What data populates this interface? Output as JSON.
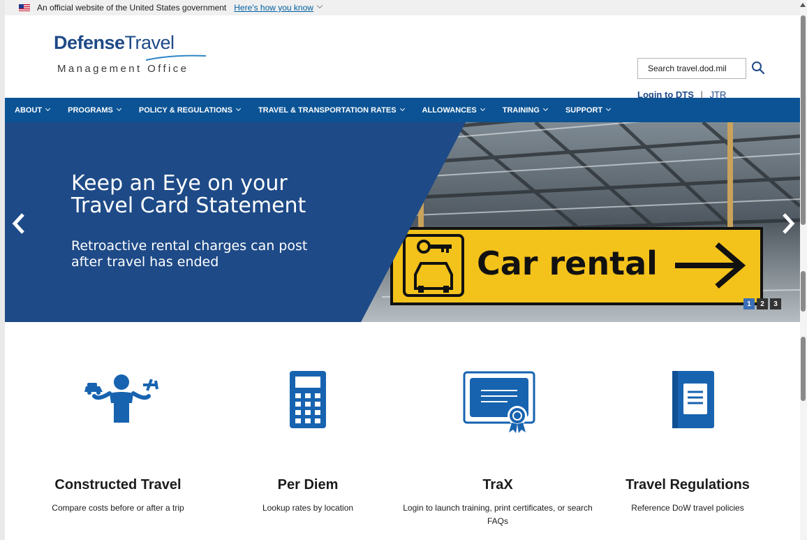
{
  "gov_banner": {
    "text": "An official website of the United States government",
    "link": "Here's how you know"
  },
  "logo": {
    "name_bold": "Defense",
    "name_light": "Travel",
    "subtitle": "Management Office"
  },
  "header": {
    "search_placeholder": "Search travel.dod.mil",
    "login_label": "Login to DTS",
    "separator": "|",
    "jtr_label": "JTR"
  },
  "nav": {
    "items": [
      {
        "label": "ABOUT"
      },
      {
        "label": "PROGRAMS"
      },
      {
        "label": "POLICY & REGULATIONS"
      },
      {
        "label": "TRAVEL & TRANSPORTATION RATES"
      },
      {
        "label": "ALLOWANCES"
      },
      {
        "label": "TRAINING"
      },
      {
        "label": "SUPPORT"
      }
    ]
  },
  "hero": {
    "title_line1": "Keep an Eye on your",
    "title_line2": "Travel Card Statement",
    "sub_line1": "Retroactive rental charges can post",
    "sub_line2": "after travel has ended",
    "sign_text": "Car rental",
    "slides": [
      "1",
      "2",
      "3"
    ],
    "active_slide": "1"
  },
  "cards": [
    {
      "title": "Constructed Travel",
      "desc": "Compare costs before or after a trip",
      "icon": "person-balance-car-plane-icon"
    },
    {
      "title": "Per Diem",
      "desc": "Lookup rates by location",
      "icon": "calculator-icon"
    },
    {
      "title": "TraX",
      "desc": "Login to launch training, print certificates, or search FAQs",
      "icon": "certificate-icon"
    },
    {
      "title": "Travel Regulations",
      "desc": "Reference DoW travel policies",
      "icon": "book-icon"
    }
  ],
  "colors": {
    "brand_blue": "#1e4a87",
    "nav_blue": "#0b5394",
    "sign_yellow": "#f3c21b",
    "icon_blue": "#1763b0"
  }
}
